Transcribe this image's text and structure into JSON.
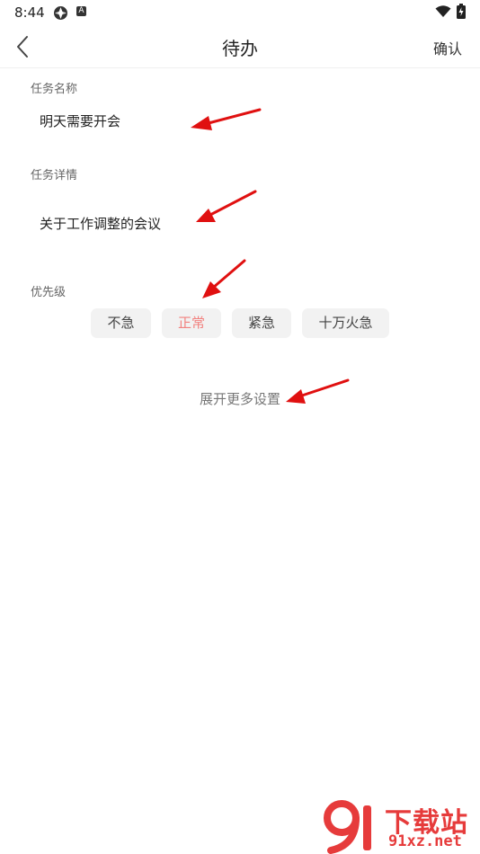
{
  "status_bar": {
    "time": "8:44"
  },
  "nav": {
    "title": "待办",
    "confirm_label": "确认"
  },
  "form": {
    "task_name_label": "任务名称",
    "task_name_value": "明天需要开会",
    "task_detail_label": "任务详情",
    "task_detail_value": "关于工作调整的会议",
    "priority_label": "优先级",
    "priority_options": [
      "不急",
      "正常",
      "紧急",
      "十万火急"
    ],
    "priority_selected": "正常",
    "more_settings_label": "展开更多设置"
  },
  "watermark": {
    "title": "下载站",
    "domain": "91xz.net"
  },
  "colors": {
    "accent": "#f2817f",
    "annotation_arrow": "#e01010"
  }
}
